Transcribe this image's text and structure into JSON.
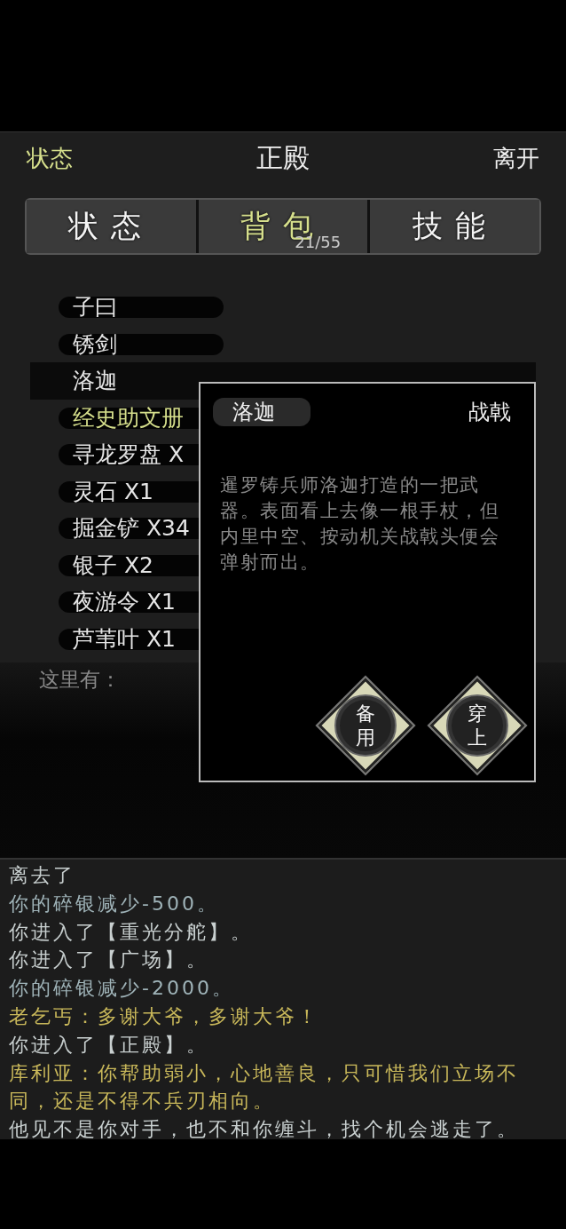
{
  "header": {
    "left": "状态",
    "title": "正殿",
    "right": "离开"
  },
  "tabs": [
    {
      "label": "状态",
      "selected": false
    },
    {
      "label": "背包",
      "selected": true,
      "count": "21/55"
    },
    {
      "label": "技能",
      "selected": false
    }
  ],
  "inventory": [
    {
      "name": "子曰",
      "selected": false,
      "color": "#e6e6e6"
    },
    {
      "name": "锈剑",
      "selected": false,
      "color": "#e6e6e6"
    },
    {
      "name": "洛迦",
      "selected": true,
      "color": "#e6e6e6"
    },
    {
      "name": "经史助文册",
      "selected": false,
      "color": "#d6df8c"
    },
    {
      "name": "寻龙罗盘 X",
      "selected": false,
      "color": "#e6e6e6"
    },
    {
      "name": "灵石 X1",
      "selected": false,
      "color": "#e6e6e6"
    },
    {
      "name": "掘金铲 X34",
      "selected": false,
      "color": "#e6e6e6"
    },
    {
      "name": "银子 X2",
      "selected": false,
      "color": "#e6e6e6"
    },
    {
      "name": "夜游令 X1",
      "selected": false,
      "color": "#e6e6e6"
    },
    {
      "name": "芦苇叶 X1",
      "selected": false,
      "color": "#e6e6e6"
    }
  ],
  "item_popup": {
    "name": "洛迦",
    "type": "战戟",
    "description": "暹罗铸兵师洛迦打造的一把武器。表面看上去像一根手杖，但内里中空、按动机关战戟头便会弹射而出。",
    "buttons": [
      "备用",
      "穿上"
    ]
  },
  "here": {
    "label": "这里有："
  },
  "log": [
    {
      "text": "离去了",
      "color": "#c8cfcf"
    },
    {
      "text": "你的碎银减少-500。",
      "color": "#9fb3b8"
    },
    {
      "text": "你进入了【重光分舵】。",
      "color": "#c8cfcf"
    },
    {
      "text": "你进入了【广场】。",
      "color": "#c8cfcf"
    },
    {
      "text": "你的碎银减少-2000。",
      "color": "#9fb3b8"
    },
    {
      "text": "老乞丐：多谢大爷，多谢大爷！",
      "color": "#c9b85a"
    },
    {
      "text": "你进入了【正殿】。",
      "color": "#c8cfcf"
    },
    {
      "text": "库利亚：你帮助弱小，心地善良，只可惜我们立场不同，还是不得不兵刃相向。",
      "color": "#c9b85a"
    },
    {
      "text": "他见不是你对手，也不和你缠斗，找个机会逃走了。",
      "color": "#c8cfcf"
    }
  ]
}
